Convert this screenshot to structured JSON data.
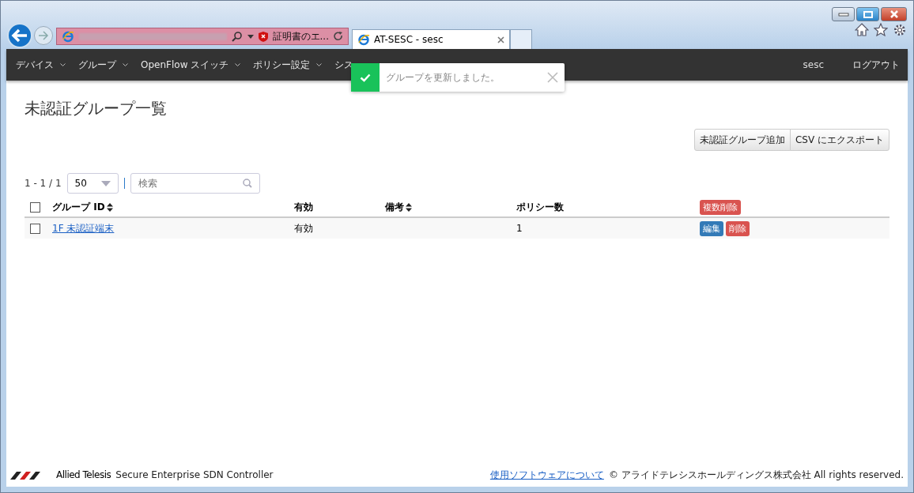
{
  "browser": {
    "address_warning": "証明書のエ...",
    "tab_title": "AT-SESC - sesc"
  },
  "navbar": {
    "menus": [
      {
        "label": "デバイス"
      },
      {
        "label": "グループ"
      },
      {
        "label": "OpenFlow スイッチ"
      },
      {
        "label": "ポリシー設定"
      },
      {
        "label": "シス"
      }
    ],
    "user": "sesc",
    "logout": "ログアウト"
  },
  "toast": {
    "message": "グループを更新しました。"
  },
  "page": {
    "title": "未認証グループ一覧",
    "buttons": [
      "未認証グループ追加",
      "CSV にエクスポート"
    ]
  },
  "list_controls": {
    "count": "1 - 1 / 1",
    "page_size": "50",
    "search_placeholder": "検索"
  },
  "table": {
    "select_all_checked": false,
    "columns": [
      {
        "label": "グループ ID",
        "sortable": true
      },
      {
        "label": "有効",
        "sortable": false
      },
      {
        "label": "備考",
        "sortable": true
      },
      {
        "label": "ポリシー数",
        "sortable": false
      }
    ],
    "bulk_delete": "複数削除",
    "rows": [
      {
        "checked": false,
        "group_id": "1F 未認証端末",
        "enabled": "有効",
        "policies": "1",
        "edit": "編集",
        "delete": "削除"
      }
    ]
  },
  "footer": {
    "brand": "Allied Telesis",
    "product": "Secure Enterprise SDN Controller",
    "link": "使用ソフトウェアについて",
    "copyright": "© アライドテレシスホールディングス株式会社 All rights reserved."
  }
}
